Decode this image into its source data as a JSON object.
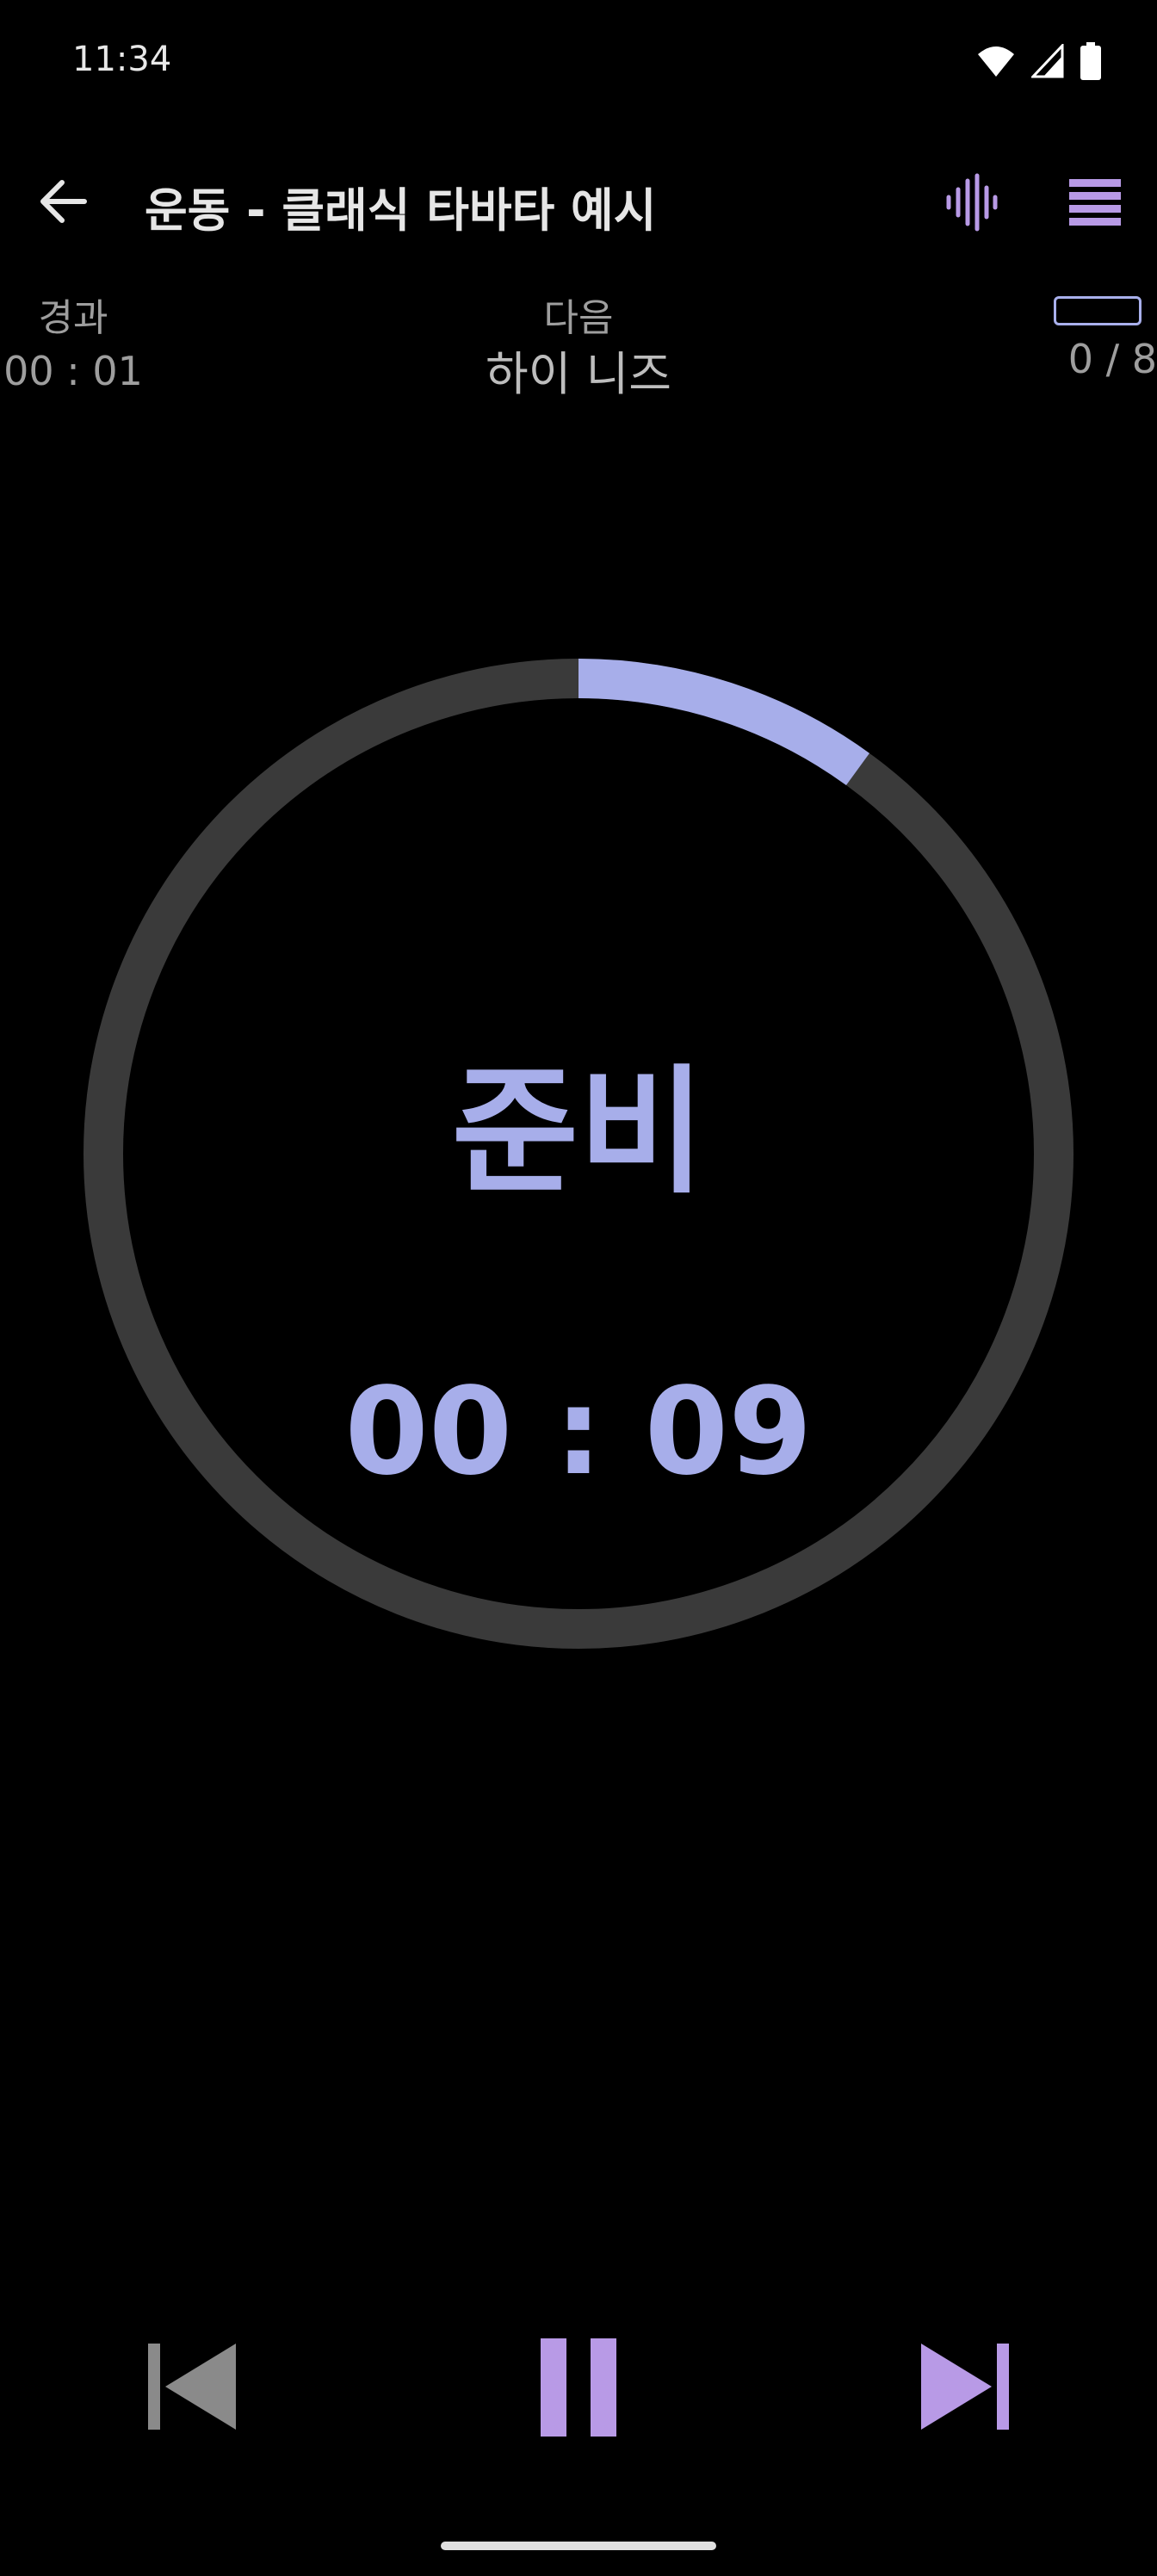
{
  "status_bar": {
    "time": "11:34"
  },
  "app_bar": {
    "title": "운동 - 클래식 타바타 예시"
  },
  "info": {
    "elapsed_label": "경과",
    "elapsed_value": "00 : 01",
    "next_label": "다음",
    "next_value": "하이 니즈",
    "round_count": "0 / 8"
  },
  "timer": {
    "phase": "준비",
    "remaining": "00 : 09",
    "progress_fraction": 0.1
  },
  "colors": {
    "accent": "#a7aeea",
    "accent_purple": "#b89ae6",
    "ring_track": "#3a3a3a",
    "disabled": "#8a8a8a"
  },
  "icons": [
    "back-arrow-icon",
    "sound-wave-icon",
    "menu-icon",
    "skip-previous-icon",
    "pause-icon",
    "skip-next-icon",
    "wifi-icon",
    "signal-icon",
    "battery-icon"
  ]
}
